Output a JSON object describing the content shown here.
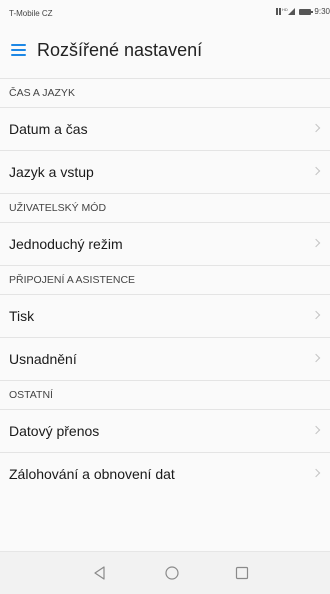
{
  "status_bar": {
    "carrier": "T-Mobile CZ",
    "time": "9:30"
  },
  "header": {
    "menu_icon": "hamburger-menu-icon",
    "title": "Rozšířené nastavení"
  },
  "sections": [
    {
      "title": "ČAS A JAZYK",
      "items": [
        {
          "label": "Datum a čas"
        },
        {
          "label": "Jazyk a vstup"
        }
      ]
    },
    {
      "title": "UŽIVATELSKÝ MÓD",
      "items": [
        {
          "label": "Jednoduchý režim"
        }
      ]
    },
    {
      "title": "PŘIPOJENÍ A ASISTENCE",
      "items": [
        {
          "label": "Tisk"
        },
        {
          "label": "Usnadnění"
        }
      ]
    },
    {
      "title": "OSTATNÍ",
      "items": [
        {
          "label": "Datový přenos"
        },
        {
          "label": "Zálohování a obnovení dat"
        }
      ]
    }
  ],
  "nav_bar": {
    "back_icon": "back-triangle-icon",
    "home_icon": "home-circle-icon",
    "recent_icon": "recent-apps-square-icon"
  },
  "colors": {
    "accent": "#1e88e5",
    "background": "#fafafa",
    "divider": "#e4e4e4"
  }
}
